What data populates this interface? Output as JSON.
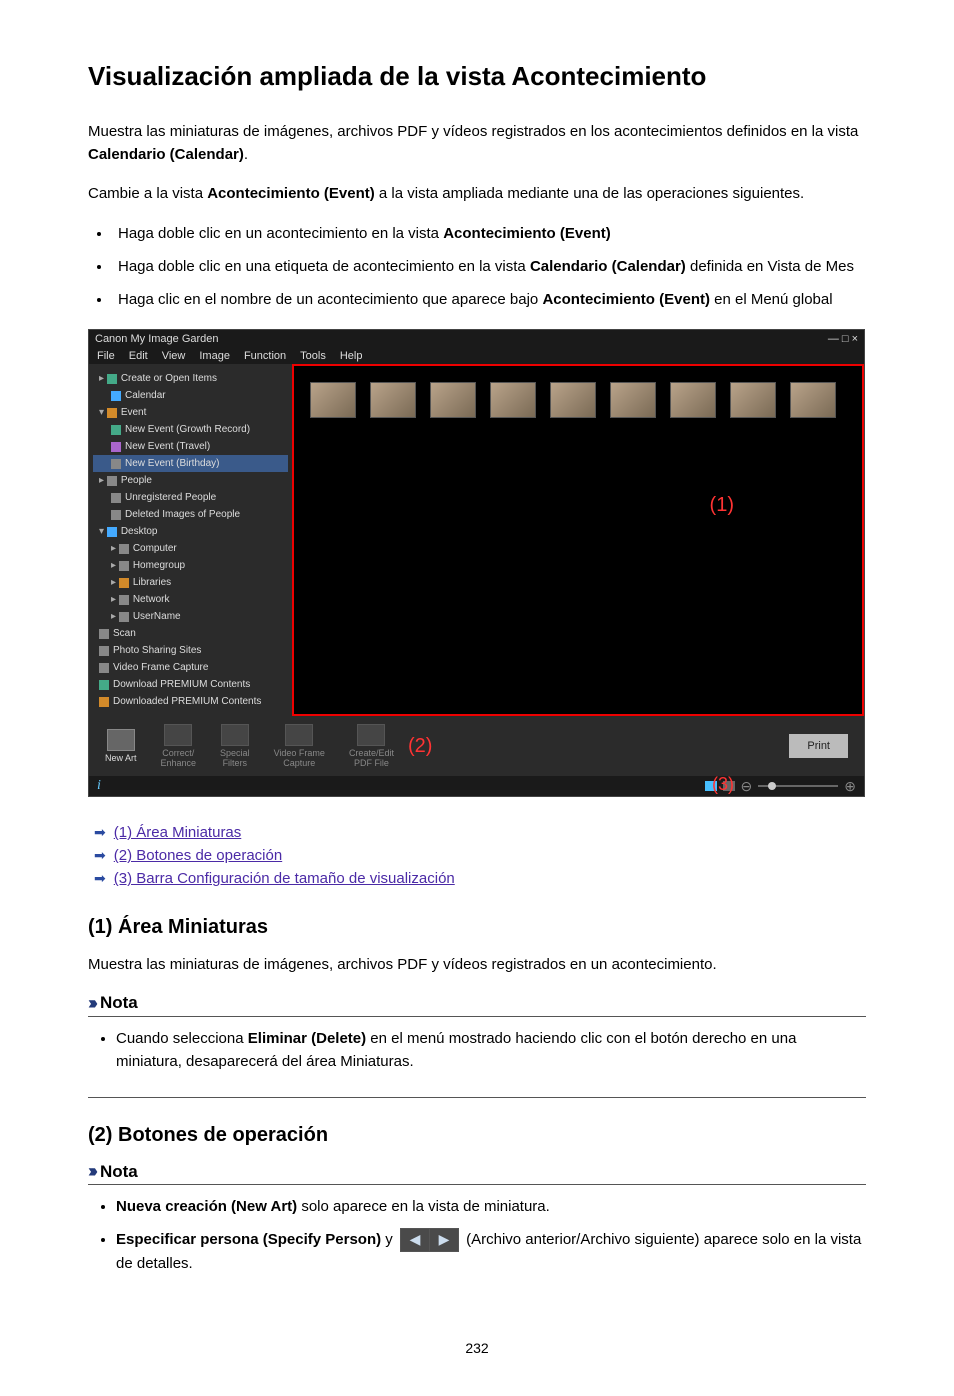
{
  "title": "Visualización ampliada de la vista Acontecimiento",
  "intro_p1_a": "Muestra las miniaturas de imágenes, archivos PDF y vídeos registrados en los acontecimientos definidos en la vista ",
  "intro_p1_b_strong": "Calendario (Calendar)",
  "intro_p1_c": ".",
  "intro_p2_a": "Cambie a la vista ",
  "intro_p2_b_strong": "Acontecimiento (Event)",
  "intro_p2_c": " a la vista ampliada mediante una de las operaciones siguientes.",
  "bullets": {
    "b1_a": "Haga doble clic en un acontecimiento en la vista ",
    "b1_b_strong": "Acontecimiento (Event)",
    "b2_a": "Haga doble clic en una etiqueta de acontecimiento en la vista ",
    "b2_b_strong": "Calendario (Calendar)",
    "b2_c": " definida en Vista de Mes",
    "b3_a": "Haga clic en el nombre de un acontecimiento que aparece bajo ",
    "b3_b_strong": "Acontecimiento (Event)",
    "b3_c": " en el Menú global"
  },
  "shot": {
    "title": "Canon My Image Garden",
    "win_controls": "—  □  ×",
    "menus": [
      "File",
      "Edit",
      "View",
      "Image",
      "Function",
      "Tools",
      "Help"
    ],
    "tree": [
      {
        "lvl": 0,
        "txt": "Create or Open Items",
        "ico": "ico-green",
        "caret": "▸"
      },
      {
        "lvl": 1,
        "txt": "Calendar",
        "ico": "ico-blue"
      },
      {
        "lvl": 0,
        "txt": "Event",
        "ico": "ico-folder",
        "caret": "▾"
      },
      {
        "lvl": 1,
        "txt": "New Event (Growth Record)",
        "ico": "ico-green"
      },
      {
        "lvl": 1,
        "txt": "New Event (Travel)",
        "ico": "ico-purple"
      },
      {
        "lvl": 1,
        "txt": "New Event (Birthday)",
        "ico": "ico-gray",
        "sel": true
      },
      {
        "lvl": 0,
        "txt": "People",
        "ico": "ico-gray",
        "caret": "▸"
      },
      {
        "lvl": 1,
        "txt": "Unregistered People",
        "ico": "ico-gray"
      },
      {
        "lvl": 1,
        "txt": "Deleted Images of People",
        "ico": "ico-gray"
      },
      {
        "lvl": 0,
        "txt": "Desktop",
        "ico": "ico-blue",
        "caret": "▾"
      },
      {
        "lvl": 1,
        "txt": "Computer",
        "ico": "ico-gray",
        "caret": "▸"
      },
      {
        "lvl": 1,
        "txt": "Homegroup",
        "ico": "ico-gray",
        "caret": "▸"
      },
      {
        "lvl": 1,
        "txt": "Libraries",
        "ico": "ico-folder",
        "caret": "▸"
      },
      {
        "lvl": 1,
        "txt": "Network",
        "ico": "ico-gray",
        "caret": "▸"
      },
      {
        "lvl": 1,
        "txt": "UserName",
        "ico": "ico-gray",
        "caret": "▸"
      },
      {
        "lvl": 0,
        "txt": "Scan",
        "ico": "ico-gray"
      },
      {
        "lvl": 0,
        "txt": "Photo Sharing Sites",
        "ico": "ico-gray"
      },
      {
        "lvl": 0,
        "txt": "Video Frame Capture",
        "ico": "ico-gray"
      },
      {
        "lvl": 0,
        "txt": "Download PREMIUM Contents",
        "ico": "ico-green"
      },
      {
        "lvl": 0,
        "txt": "Downloaded PREMIUM Contents",
        "ico": "ico-folder"
      }
    ],
    "toolbar": {
      "new_art": "New Art",
      "correct": "Correct/\nEnhance",
      "special": "Special\nFilters",
      "video": "Video Frame\nCapture",
      "pdf": "Create/Edit\nPDF File",
      "print": "Print"
    },
    "info_icon": "i",
    "markers": {
      "m1": "(1)",
      "m2": "(2)",
      "m3": "(3)"
    }
  },
  "anchors": {
    "a1": "(1) Área Miniaturas",
    "a2": "(2) Botones de operación",
    "a3": "(3) Barra Configuración de tamaño de visualización"
  },
  "sec1": {
    "heading": "(1) Área Miniaturas",
    "body": "Muestra las miniaturas de imágenes, archivos PDF y vídeos registrados en un acontecimiento.",
    "note_title": "Nota",
    "note_li_a": "Cuando selecciona ",
    "note_li_b_strong": "Eliminar (Delete)",
    "note_li_c": " en el menú mostrado haciendo clic con el botón derecho en una miniatura, desaparecerá del área Miniaturas."
  },
  "sec2": {
    "heading": "(2) Botones de operación",
    "note_title": "Nota",
    "li1_a_strong": "Nueva creación (New Art)",
    "li1_b": " solo aparece en la vista de miniatura.",
    "li2_a_strong": "Especificar persona (Specify Person)",
    "li2_b": " y ",
    "li2_c": " (Archivo anterior/Archivo siguiente) aparece solo en la vista de detalles."
  },
  "page_number": "232"
}
